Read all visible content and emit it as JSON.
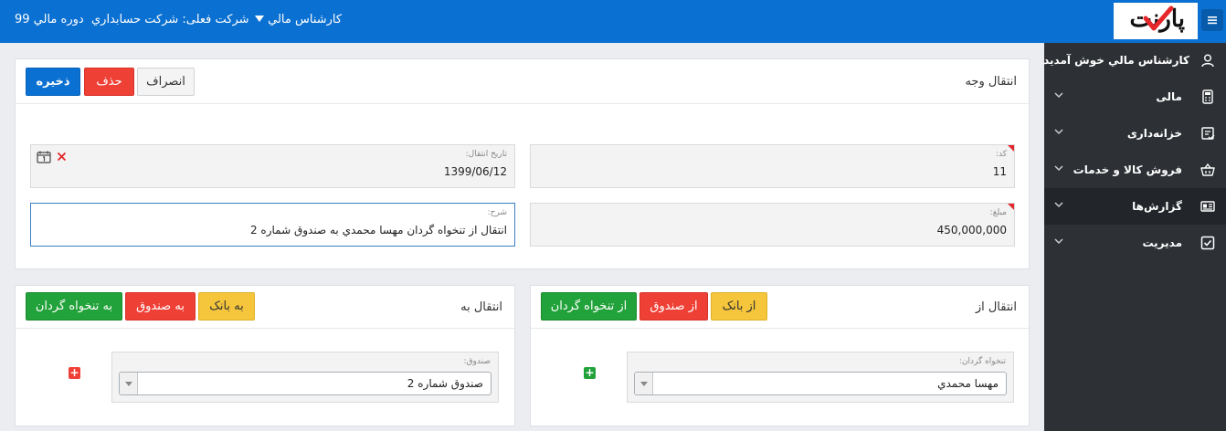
{
  "header": {
    "fiscal_period": "دوره مالي 99",
    "company": "شرکت فعلی: شرکت حسابداري",
    "user_menu": "کارشناس مالي",
    "logo_text": "پارنت"
  },
  "sidebar": {
    "welcome": "کارشناس مالي خوش آمديد",
    "items": [
      {
        "label": "مالی",
        "icon": "calculator-icon"
      },
      {
        "label": "خزانه‌داری",
        "icon": "receipt-icon"
      },
      {
        "label": "فروش کالا و خدمات",
        "icon": "basket-icon"
      },
      {
        "label": "گزارش‌ها",
        "icon": "report-icon"
      },
      {
        "label": "مدیریت",
        "icon": "checkbox-icon"
      }
    ],
    "active_index": 3
  },
  "form": {
    "title": "انتقال وجه",
    "buttons": {
      "save": "ذخيره",
      "delete": "حذف",
      "cancel": "انصراف"
    },
    "code": {
      "label": "کد:",
      "value": "11"
    },
    "transfer_date": {
      "label": "تاریخ انتقال:",
      "value": "1399/06/12"
    },
    "amount": {
      "label": "مبلغ:",
      "value": "450,000,000"
    },
    "description": {
      "label": "شرح:",
      "value": "انتقال از تنخواه گردان مهسا محمدي به صندوق شماره 2"
    }
  },
  "transfer_from": {
    "title": "انتقال از",
    "buttons": {
      "bank": "از بانک",
      "cash": "از صندوق",
      "petty": "از تنخواه گردان"
    },
    "field_label": "تنخواه گردان:",
    "selected": "مهسا محمدي"
  },
  "transfer_to": {
    "title": "انتقال به",
    "buttons": {
      "bank": "به بانک",
      "cash": "به صندوق",
      "petty": "به تنخواه گردان"
    },
    "field_label": "صندوق:",
    "selected": "صندوق شماره 2"
  },
  "colors": {
    "primary": "#0a70d1",
    "danger": "#ef4036",
    "success": "#22a23a",
    "warning": "#f5c53b",
    "sidebar": "#2d3035"
  }
}
